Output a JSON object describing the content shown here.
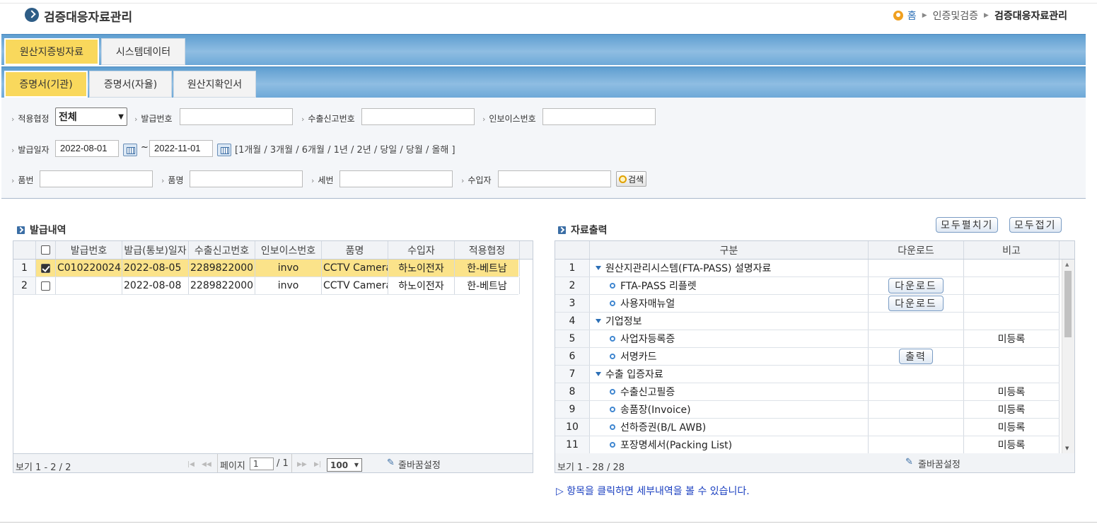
{
  "header": {
    "title": "검증대응자료관리"
  },
  "breadcrumb": {
    "home": "홈",
    "level1": "인증및검증",
    "current": "검증대응자료관리"
  },
  "tabs1": [
    {
      "label": "원산지증빙자료",
      "active": true
    },
    {
      "label": "시스템데이터",
      "active": false
    }
  ],
  "tabs2": [
    {
      "label": "증명서(기관)",
      "active": true
    },
    {
      "label": "증명서(자율)",
      "active": false
    },
    {
      "label": "원산지확인서",
      "active": false
    }
  ],
  "filter": {
    "agreement_label": "적용협정",
    "agreement_value": "전체",
    "issue_no_label": "발급번호",
    "issue_no_value": "",
    "export_decl_label": "수출신고번호",
    "export_decl_value": "",
    "invoice_label": "인보이스번호",
    "invoice_value": "",
    "issue_date_label": "발급일자",
    "date_from": "2022-08-01",
    "tilde": "~",
    "date_to": "2022-11-01",
    "quick_ranges": "[1개월 / 3개월 / 6개월 / 1년 / 2년 / 당일 / 당월 / 올해 ]",
    "item_no_label": "품번",
    "item_name_label": "품명",
    "hs_label": "세번",
    "importer_label": "수입자",
    "search_label": "검색"
  },
  "issue_list": {
    "title": "발급내역",
    "columns": [
      "",
      "",
      "발급번호",
      "발급(통보)일자",
      "수출신고번호",
      "인보이스번호",
      "품명",
      "수입자",
      "적용협정"
    ],
    "rows": [
      {
        "rn": "1",
        "checked": true,
        "issue_no": "C010220024",
        "date": "2022-08-05",
        "export_no": "2289822000",
        "invoice": "invo",
        "item": "CCTV Camera",
        "importer": "하노이전자",
        "agreement": "한-베트남"
      },
      {
        "rn": "2",
        "checked": false,
        "issue_no": "",
        "date": "2022-08-08",
        "export_no": "2289822000",
        "invoice": "invo",
        "item": "CCTV Camera",
        "importer": "하노이전자",
        "agreement": "한-베트남"
      }
    ],
    "footer": {
      "count": "보기 1 - 2 / 2",
      "page_label": "페이지",
      "page_value": "1",
      "page_total": "/ 1",
      "page_size": "100",
      "wrap": "줄바꿈설정"
    }
  },
  "output": {
    "title": "자료출력",
    "expand_all": "모두펼치기",
    "collapse_all": "모두접기",
    "columns": [
      "",
      "구분",
      "다운로드",
      "비고"
    ],
    "rows": [
      {
        "rn": "1",
        "level": 0,
        "label": "원산지관리시스템(FTA-PASS) 설명자료",
        "action": "",
        "note": ""
      },
      {
        "rn": "2",
        "level": 1,
        "label": "FTA-PASS 리플렛",
        "action": "다운로드",
        "note": ""
      },
      {
        "rn": "3",
        "level": 1,
        "label": "사용자매뉴얼",
        "action": "다운로드",
        "note": ""
      },
      {
        "rn": "4",
        "level": 0,
        "label": "기업정보",
        "action": "",
        "note": ""
      },
      {
        "rn": "5",
        "level": 1,
        "label": "사업자등록증",
        "action": "",
        "note": "미등록"
      },
      {
        "rn": "6",
        "level": 1,
        "label": "서명카드",
        "action": "출력",
        "note": ""
      },
      {
        "rn": "7",
        "level": 0,
        "label": "수출 입증자료",
        "action": "",
        "note": ""
      },
      {
        "rn": "8",
        "level": 1,
        "label": "수출신고필증",
        "action": "",
        "note": "미등록"
      },
      {
        "rn": "9",
        "level": 1,
        "label": "송품장(Invoice)",
        "action": "",
        "note": "미등록"
      },
      {
        "rn": "10",
        "level": 1,
        "label": "선하증권(B/L AWB)",
        "action": "",
        "note": "미등록"
      },
      {
        "rn": "11",
        "level": 1,
        "label": "포장명세서(Packing List)",
        "action": "",
        "note": "미등록"
      }
    ],
    "footer": {
      "count": "보기 1 - 28 / 28",
      "wrap": "줄바꿈설정"
    },
    "hint": "▷ 항목을 클릭하면 세부내역을 볼 수 있습니다."
  }
}
